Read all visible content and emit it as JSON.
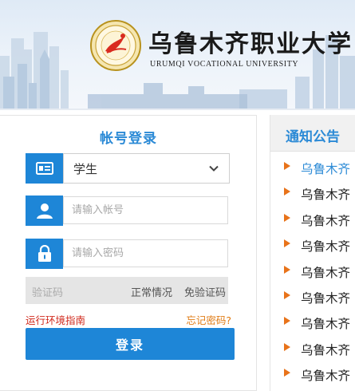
{
  "header": {
    "university_name_cn": "乌鲁木齐职业大学",
    "university_name_en": "URUMQI VOCATIONAL UNIVERSITY",
    "emblem_text": "乌鲁木齐职业大学"
  },
  "login": {
    "title": "帐号登录",
    "user_type": {
      "selected": "学生"
    },
    "account": {
      "placeholder": "请输入帐号",
      "value": ""
    },
    "password": {
      "placeholder": "请输入密码",
      "value": ""
    },
    "captcha": {
      "placeholder": "验证码",
      "status": "正常情况",
      "free_text": "免验证码"
    },
    "env_guide_label": "运行环境指南",
    "forgot_label": "忘记密码?",
    "submit_label": "登录"
  },
  "notices": {
    "title": "通知公告",
    "items": [
      {
        "label": "乌鲁木齐",
        "active": true
      },
      {
        "label": "乌鲁木齐",
        "active": false
      },
      {
        "label": "乌鲁木齐",
        "active": false
      },
      {
        "label": "乌鲁木齐",
        "active": false
      },
      {
        "label": "乌鲁木齐",
        "active": false
      },
      {
        "label": "乌鲁木齐",
        "active": false
      },
      {
        "label": "乌鲁木齐",
        "active": false
      },
      {
        "label": "乌鲁木齐",
        "active": false
      },
      {
        "label": "乌鲁木齐",
        "active": false
      }
    ]
  },
  "colors": {
    "accent_blue": "#1e86d7",
    "title_blue": "#2b8ad6",
    "notice_arrow": "#e8731a",
    "link_red": "#d0281b",
    "link_orange": "#e07b14"
  }
}
